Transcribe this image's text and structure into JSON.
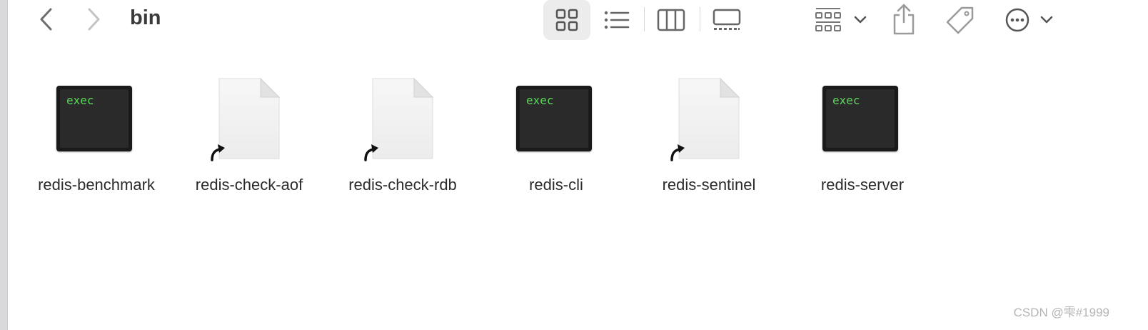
{
  "window": {
    "folder_title": "bin"
  },
  "toolbar": {
    "back_icon": "chevron-left-icon",
    "forward_icon": "chevron-right-icon",
    "view_modes": [
      "icons-view-icon",
      "list-view-icon",
      "columns-view-icon",
      "gallery-view-icon"
    ],
    "active_view": "icons",
    "group_icon": "group-grid-icon",
    "share_icon": "share-icon",
    "tag_icon": "tag-icon",
    "more_icon": "ellipsis-circle-icon"
  },
  "files": [
    {
      "name": "redis-benchmark",
      "kind": "exec",
      "icon_text": "exec"
    },
    {
      "name": "redis-check-aof",
      "kind": "alias",
      "icon_text": ""
    },
    {
      "name": "redis-check-rdb",
      "kind": "alias",
      "icon_text": ""
    },
    {
      "name": "redis-cli",
      "kind": "exec",
      "icon_text": "exec"
    },
    {
      "name": "redis-sentinel",
      "kind": "alias",
      "icon_text": ""
    },
    {
      "name": "redis-server",
      "kind": "exec",
      "icon_text": "exec"
    }
  ],
  "watermark": "CSDN @雫#1999",
  "colors": {
    "exec_text": "#5fd55f",
    "exec_bg": "#1a1a1a",
    "active_view_bg": "#ececec"
  }
}
